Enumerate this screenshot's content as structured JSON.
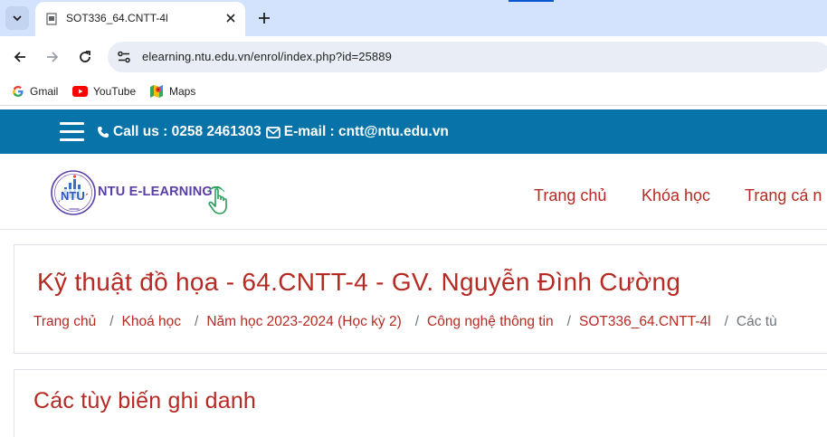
{
  "browser": {
    "tab": {
      "title": "SOT336_64.CNTT-4l"
    },
    "address_bar": {
      "url": "elearning.ntu.edu.vn/enrol/index.php?id=25889"
    },
    "bookmarks": [
      {
        "label": "Gmail",
        "icon": "google-icon"
      },
      {
        "label": "YouTube",
        "icon": "youtube-icon"
      },
      {
        "label": "Maps",
        "icon": "maps-icon"
      }
    ]
  },
  "site": {
    "colors": {
      "topbar": "#0873a8",
      "accent": "#b52a23",
      "logo_text": "#5a3ea8"
    },
    "contact": {
      "phone_label": "Call us : 0258 2461303",
      "email_label": "E-mail : cntt@ntu.edu.vn"
    },
    "logo": {
      "text": "NTU E-LEARNING",
      "badge": "NTU"
    },
    "menu": [
      "Trang chủ",
      "Khóa học",
      "Trang cá n"
    ]
  },
  "course": {
    "title": "Kỹ thuật đồ họa - 64.CNTT-4 - GV. Nguyễn Đình Cường",
    "breadcrumb": [
      "Trang chủ",
      "Khoá học",
      "Năm học 2023-2024 (Học kỳ 2)",
      "Công nghệ thông tin",
      "SOT336_64.CNTT-4l"
    ],
    "breadcrumb_current": "Các tù",
    "breadcrumb_separator": "/"
  },
  "section": {
    "title": "Các tùy biến ghi danh"
  }
}
